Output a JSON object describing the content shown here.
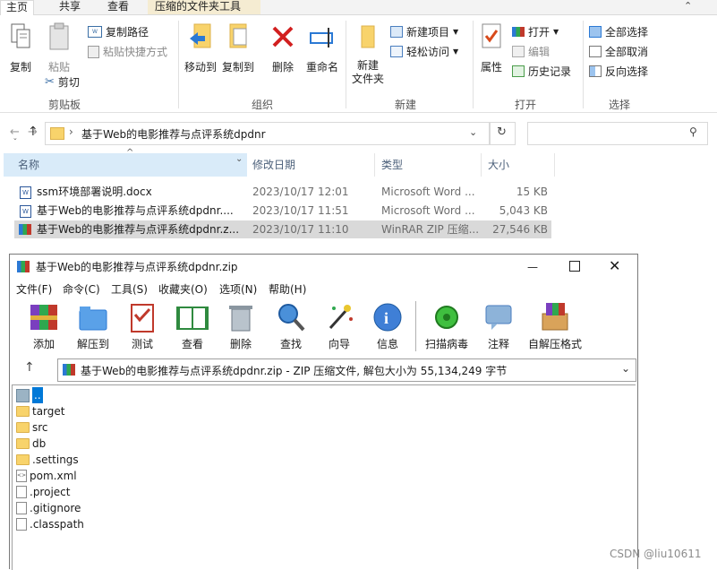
{
  "explorer": {
    "tabs": [
      "主页",
      "共享",
      "查看",
      "压缩的文件夹工具"
    ],
    "ribbon": {
      "clipboard": {
        "copy": "复制",
        "paste": "粘贴",
        "copy_path": "复制路径",
        "paste_shortcut": "粘贴快捷方式",
        "cut": "剪切",
        "group": "剪贴板"
      },
      "organize": {
        "move_to": "移动到",
        "copy_to": "复制到",
        "delete": "删除",
        "rename": "重命名",
        "group": "组织"
      },
      "new": {
        "new_folder_line1": "新建",
        "new_folder_line2": "文件夹",
        "new_item": "新建项目",
        "easy_access": "轻松访问",
        "group": "新建"
      },
      "open": {
        "properties": "属性",
        "open": "打开",
        "edit": "编辑",
        "history": "历史记录",
        "group": "打开"
      },
      "select": {
        "select_all": "全部选择",
        "select_none": "全部取消",
        "invert": "反向选择",
        "group": "选择"
      }
    },
    "address": {
      "path": "基于Web的电影推荐与点评系统dpdnr"
    },
    "columns": {
      "name": "名称",
      "modified": "修改日期",
      "type": "类型",
      "size": "大小"
    },
    "files": [
      {
        "name": "ssm环境部署说明.docx",
        "modified": "2023/10/17 12:01",
        "type": "Microsoft Word ...",
        "size": "15 KB",
        "kind": "word"
      },
      {
        "name": "基于Web的电影推荐与点评系统dpdnr....",
        "modified": "2023/10/17 11:51",
        "type": "Microsoft Word ...",
        "size": "5,043 KB",
        "kind": "word"
      },
      {
        "name": "基于Web的电影推荐与点评系统dpdnr.z...",
        "modified": "2023/10/17 11:10",
        "type": "WinRAR ZIP 压缩...",
        "size": "27,546 KB",
        "kind": "rar"
      }
    ]
  },
  "winrar": {
    "title": "基于Web的电影推荐与点评系统dpdnr.zip",
    "menu": [
      "文件(F)",
      "命令(C)",
      "工具(S)",
      "收藏夹(O)",
      "选项(N)",
      "帮助(H)"
    ],
    "toolbar": [
      "添加",
      "解压到",
      "测试",
      "查看",
      "删除",
      "查找",
      "向导",
      "信息",
      "扫描病毒",
      "注释",
      "自解压格式"
    ],
    "path": "基于Web的电影推荐与点评系统dpdnr.zip - ZIP 压缩文件, 解包大小为 55,134,249 字节",
    "entries": [
      {
        "name": "..",
        "kind": "up"
      },
      {
        "name": "target",
        "kind": "folder"
      },
      {
        "name": "src",
        "kind": "folder"
      },
      {
        "name": "db",
        "kind": "folder"
      },
      {
        "name": ".settings",
        "kind": "folder"
      },
      {
        "name": "pom.xml",
        "kind": "xml"
      },
      {
        "name": ".project",
        "kind": "file"
      },
      {
        "name": ".gitignore",
        "kind": "file"
      },
      {
        "name": ".classpath",
        "kind": "file"
      }
    ]
  },
  "watermark": "CSDN @liu10611",
  "colors": {
    "accent": "#0078d7",
    "selected_row": "#cce8ff",
    "highlight": "#d9d9d9"
  }
}
